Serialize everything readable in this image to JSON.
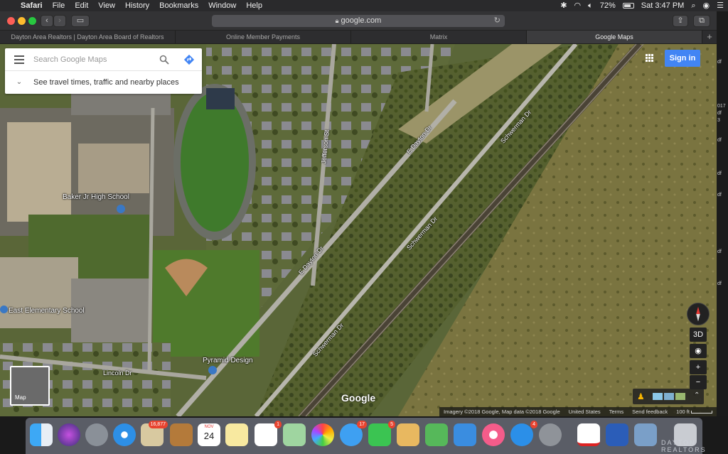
{
  "menubar": {
    "app": "Safari",
    "items": [
      "File",
      "Edit",
      "View",
      "History",
      "Bookmarks",
      "Window",
      "Help"
    ],
    "battery": "72%",
    "clock": "Sat 3:47 PM"
  },
  "toolbar": {
    "url": "google.com"
  },
  "tabs": [
    {
      "label": "Dayton Area Realtors | Dayton Area Board of Realtors"
    },
    {
      "label": "Online Member Payments"
    },
    {
      "label": "Matrix"
    },
    {
      "label": "Google Maps"
    }
  ],
  "maps": {
    "search_placeholder": "Search Google Maps",
    "travel_text": "See travel times, traffic and nearby places",
    "signin_label": "Sign in",
    "minimap_label": "Map",
    "ctl_3d": "3D",
    "ctl_plus": "+",
    "ctl_minus": "−",
    "logo": "Google",
    "attribution": {
      "imagery": "Imagery ©2018 Google, Map data ©2018 Google",
      "country": "United States",
      "terms": "Terms",
      "feedback": "Send feedback",
      "scale": "100 ft"
    },
    "labels": {
      "baker": "Baker Jr High School",
      "east": "East Elementary School",
      "pyramid": "Pyramid Design",
      "lincoln": "Lincoln Dr",
      "jefferson": "Jefferson St",
      "dayton1": "E Dayton Dr",
      "dayton2": "E Dayton Dr",
      "schwerman1": "Schwerman Dr",
      "schwerman2": "Schwerman Dr",
      "schwerman3": "Schwerman Dr"
    }
  },
  "edge_strip": [
    "df",
    "017",
    "df",
    "3",
    "df",
    "df",
    "df",
    "df",
    "df"
  ],
  "dock": {
    "badges": {
      "mail": "16,877",
      "reminders": "1",
      "messages": "17",
      "facetime": "5",
      "appstore": "4"
    },
    "calendar_month": "NOV",
    "calendar_day": "24"
  },
  "watermark": "DAYTON REALTORS"
}
